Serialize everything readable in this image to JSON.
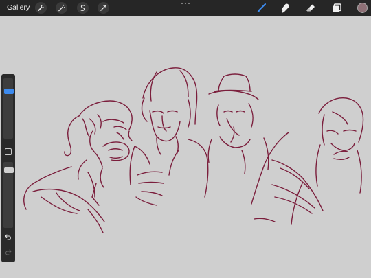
{
  "toolbar": {
    "gallery_label": "Gallery",
    "left_tools": [
      "actions-wrench-icon",
      "adjustments-wand-icon",
      "selection-s-icon",
      "transform-arrow-icon"
    ],
    "right_tools": [
      "brush-icon",
      "smudge-icon",
      "eraser-icon",
      "layers-icon"
    ],
    "active_tool": "brush-icon",
    "accent_color": "#3d8bef",
    "current_color": "#8e7076"
  },
  "sidebar": {
    "brush_size_level": 0.9,
    "opacity_level": 0.35
  },
  "canvas": {
    "background": "#cfcfcf",
    "ink_color": "#7b1e3c"
  }
}
